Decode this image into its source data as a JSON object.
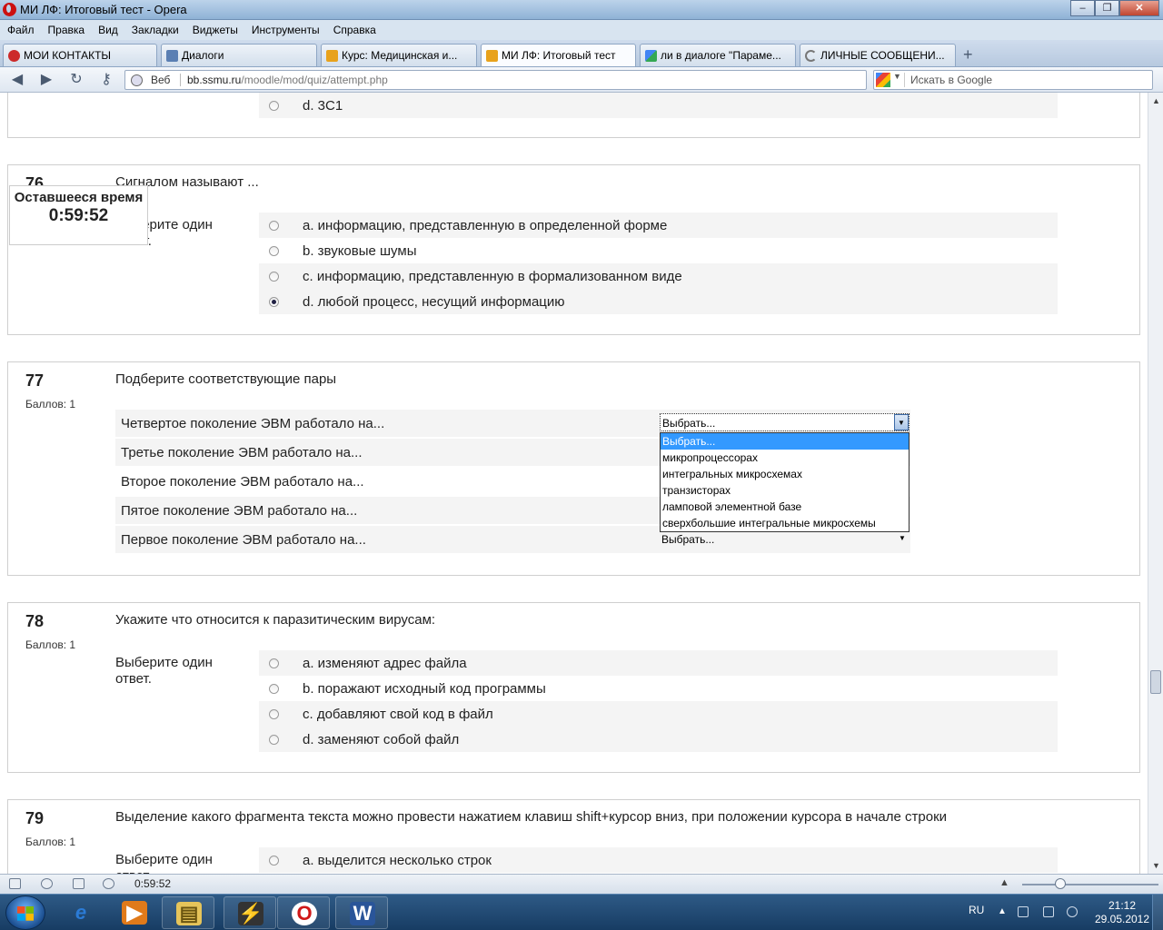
{
  "window": {
    "title": "МИ ЛФ: Итоговый тест - Opera",
    "min": "–",
    "max": "❐",
    "close": "✕"
  },
  "menu": [
    "Файл",
    "Правка",
    "Вид",
    "Закладки",
    "Виджеты",
    "Инструменты",
    "Справка"
  ],
  "tabs": [
    {
      "label": "МОИ КОНТАКТЫ",
      "icon": "vk-icon",
      "color": "#cc2a2a"
    },
    {
      "label": "Диалоги",
      "icon": "dialogs-icon",
      "color": "#5a7fb3"
    },
    {
      "label": "Курс: Медицинская и...",
      "icon": "moodle-icon",
      "color": "#e8a21c"
    },
    {
      "label": "МИ ЛФ: Итоговый тест",
      "icon": "moodle-icon",
      "color": "#e8a21c"
    },
    {
      "label": "ли в диалоге \"Параме...",
      "icon": "google-icon",
      "color": "#4285f4"
    },
    {
      "label": "ЛИЧНЫЕ СООБЩЕНИ...",
      "icon": "loading-icon",
      "color": "#777777"
    }
  ],
  "nav": {
    "web_label": "Веб",
    "url_domain": "bb.ssmu.ru",
    "url_path": "/moodle/mod/quiz/attempt.php",
    "search_placeholder": "Искать в Google"
  },
  "timer": {
    "label": "Оставшееся время",
    "value": "0:59:52"
  },
  "q75_tail": {
    "option": "d. 3С1"
  },
  "q76": {
    "number": "76",
    "text": "Сигналом называют ...",
    "hint": "Выберите один ответ.",
    "options": [
      {
        "label": "a. информацию, представленную в определенной форме",
        "checked": false
      },
      {
        "label": "b. звуковые шумы",
        "checked": false
      },
      {
        "label": "c. информацию, представленную в формализованном виде",
        "checked": false
      },
      {
        "label": "d. любой процесс, несущий информацию",
        "checked": true
      }
    ]
  },
  "q77": {
    "number": "77",
    "grade": "Баллов: 1",
    "text": "Подберите соответствующие пары",
    "rows": [
      {
        "label": "Четвертое поколение ЭВМ работало на...",
        "value": "Выбрать..."
      },
      {
        "label": "Третье поколение ЭВМ работало на...",
        "value": "Выбрать..."
      },
      {
        "label": "Второе поколение ЭВМ работало на...",
        "value": "Выбрать..."
      },
      {
        "label": "Пятое поколение ЭВМ работало на...",
        "value": "Выбрать..."
      },
      {
        "label": "Первое поколение ЭВМ работало на...",
        "value": "Выбрать..."
      }
    ],
    "dropdown_options": [
      "Выбрать...",
      "микропроцессорах",
      "интегральных микросхемах",
      "транзисторах",
      "ламповой элементной базе",
      "сверхбольшие интегральные микросхемы"
    ]
  },
  "q78": {
    "number": "78",
    "grade": "Баллов: 1",
    "text": "Укажите что относится к паразитическим вирусам:",
    "hint": "Выберите один ответ.",
    "options": [
      {
        "label": "a. изменяют адрес файла",
        "checked": false
      },
      {
        "label": "b. поражают исходный код программы",
        "checked": false
      },
      {
        "label": "c. добавляют свой код в файл",
        "checked": false
      },
      {
        "label": "d. заменяют собой файл",
        "checked": false
      }
    ]
  },
  "q79": {
    "number": "79",
    "grade": "Баллов: 1",
    "text": "Выделение какого фрагмента текста можно провести нажатием клавиш shift+курсор вниз, при положении курсора в начале строки",
    "hint": "Выберите один ответ.",
    "options": [
      {
        "label": "a. выделится несколько строк",
        "checked": false
      }
    ]
  },
  "statusbar": {
    "time": "0:59:52"
  },
  "taskbar": {
    "lang": "RU",
    "time": "21:12",
    "date": "29.05.2012",
    "apps": [
      {
        "name": "ie-icon",
        "glyph": "e",
        "color": "#2b7bd6"
      },
      {
        "name": "media-player-icon",
        "glyph": "▶",
        "color": "#e07a1a"
      },
      {
        "name": "explorer-icon",
        "glyph": "▤",
        "color": "#e6c45a"
      },
      {
        "name": "winamp-icon",
        "glyph": "⚡",
        "color": "#333333"
      },
      {
        "name": "opera-icon",
        "glyph": "O",
        "color": "#d01818"
      },
      {
        "name": "word-icon",
        "glyph": "W",
        "color": "#2a5599"
      }
    ]
  }
}
